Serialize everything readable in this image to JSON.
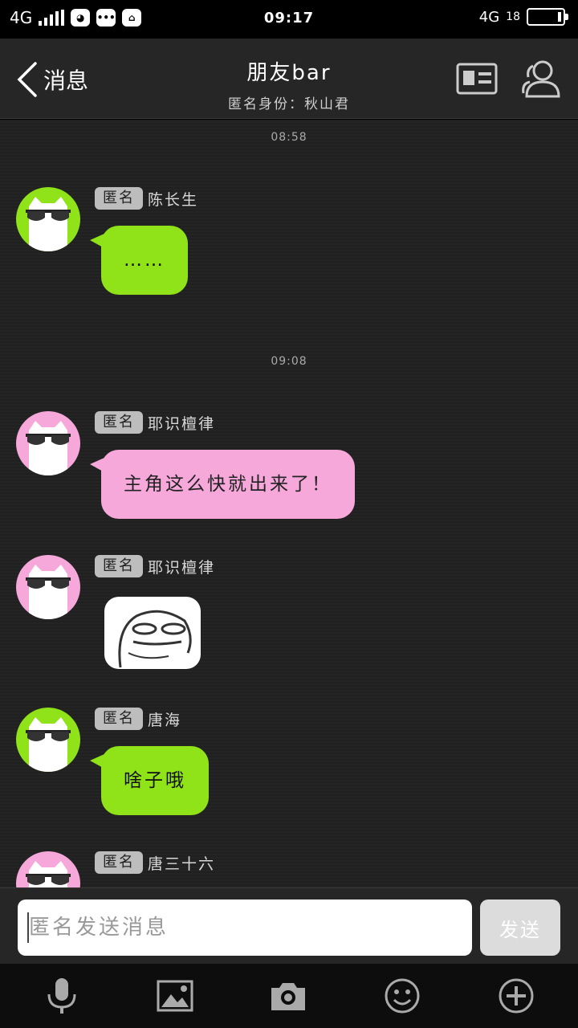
{
  "status_bar": {
    "network_left": "4G",
    "time": "09:17",
    "network_right": "4G",
    "battery_text": "18"
  },
  "header": {
    "back_label": "消息",
    "title": "朋友bar",
    "subtitle": "匿名身份：秋山君"
  },
  "messages": [
    {
      "timestamp": "08:58"
    },
    {
      "tag": "匿名",
      "nick": "陈长生",
      "text": "……",
      "bubble_color": "#8fe318",
      "avatar_color": "#8fe318"
    },
    {
      "timestamp": "09:08"
    },
    {
      "tag": "匿名",
      "nick": "耶识檀律",
      "text": "主角这么快就出来了！",
      "bubble_color": "#f6a8da",
      "avatar_color": "#f6a8da"
    },
    {
      "tag": "匿名",
      "nick": "耶识檀律",
      "sticker": "meme-face",
      "avatar_color": "#f6a8da"
    },
    {
      "tag": "匿名",
      "nick": "唐海",
      "text": "啥子哦",
      "bubble_color": "#8fe318",
      "avatar_color": "#8fe318"
    },
    {
      "tag": "匿名",
      "nick": "唐三十六",
      "avatar_color": "#f6a8da"
    }
  ],
  "input": {
    "placeholder": "匿名发送消息",
    "send_label": "发送"
  },
  "toolbar": {
    "icons": [
      "microphone-icon",
      "image-icon",
      "camera-icon",
      "emoji-icon",
      "plus-icon"
    ]
  }
}
